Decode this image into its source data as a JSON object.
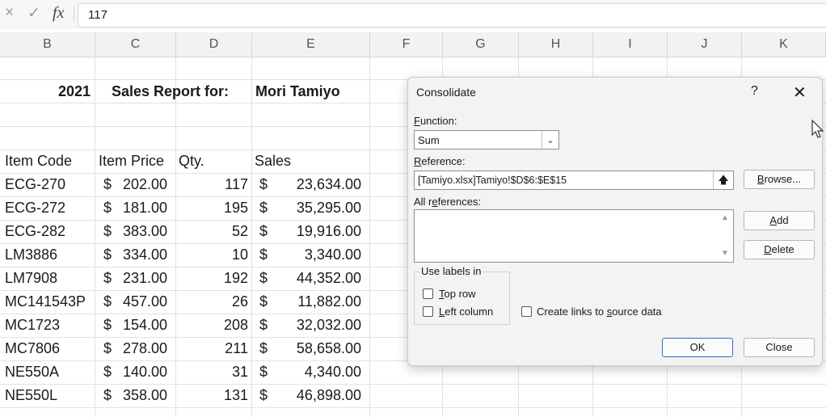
{
  "formula_bar": {
    "cancel_icon": "×",
    "enter_icon": "✓",
    "fx_label": "fx",
    "value": "117"
  },
  "columns": [
    "B",
    "C",
    "D",
    "E",
    "F",
    "G",
    "H",
    "I",
    "J",
    "K"
  ],
  "sheet": {
    "report": {
      "year": "2021",
      "title": "Sales Report for:",
      "name": "Mori Tamiyo"
    },
    "headers": {
      "item_code": "Item Code",
      "item_price": "Item Price",
      "qty": "Qty.",
      "sales": "Sales"
    },
    "rows": [
      {
        "code": "ECG-270",
        "price": "202.00",
        "qty": "117",
        "sales": "23,634.00"
      },
      {
        "code": "ECG-272",
        "price": "181.00",
        "qty": "195",
        "sales": "35,295.00"
      },
      {
        "code": "ECG-282",
        "price": "383.00",
        "qty": "52",
        "sales": "19,916.00"
      },
      {
        "code": "LM3886",
        "price": "334.00",
        "qty": "10",
        "sales": "3,340.00"
      },
      {
        "code": "LM7908",
        "price": "231.00",
        "qty": "192",
        "sales": "44,352.00"
      },
      {
        "code": "MC141543P",
        "price": "457.00",
        "qty": "26",
        "sales": "11,882.00"
      },
      {
        "code": "MC1723",
        "price": "154.00",
        "qty": "208",
        "sales": "32,032.00"
      },
      {
        "code": "MC7806",
        "price": "278.00",
        "qty": "211",
        "sales": "58,658.00"
      },
      {
        "code": "NE550A",
        "price": "140.00",
        "qty": "31",
        "sales": "4,340.00"
      },
      {
        "code": "NE550L",
        "price": "358.00",
        "qty": "131",
        "sales": "46,898.00"
      }
    ],
    "currency_symbol": "$"
  },
  "dialog": {
    "title": "Consolidate",
    "help": "?",
    "close": "✕",
    "function_label_u": "F",
    "function_label_rest": "unction:",
    "function_value": "Sum",
    "reference_label_u": "R",
    "reference_label_rest": "eference:",
    "reference_value": "[Tamiyo.xlsx]Tamiyo!$D$6:$E$15",
    "all_refs_label_a": "All r",
    "all_refs_label_u": "e",
    "all_refs_label_b": "ferences:",
    "browse_u": "B",
    "browse_rest": "rowse...",
    "add_u": "A",
    "add_rest": "dd",
    "delete_u": "D",
    "delete_rest": "elete",
    "use_labels": "Use labels in",
    "top_row_u": "T",
    "top_row_rest": "op row",
    "left_col_u": "L",
    "left_col_rest": "eft column",
    "links_a": "Create links to ",
    "links_u": "s",
    "links_b": "ource data",
    "ok": "OK",
    "close_button": "Close"
  }
}
